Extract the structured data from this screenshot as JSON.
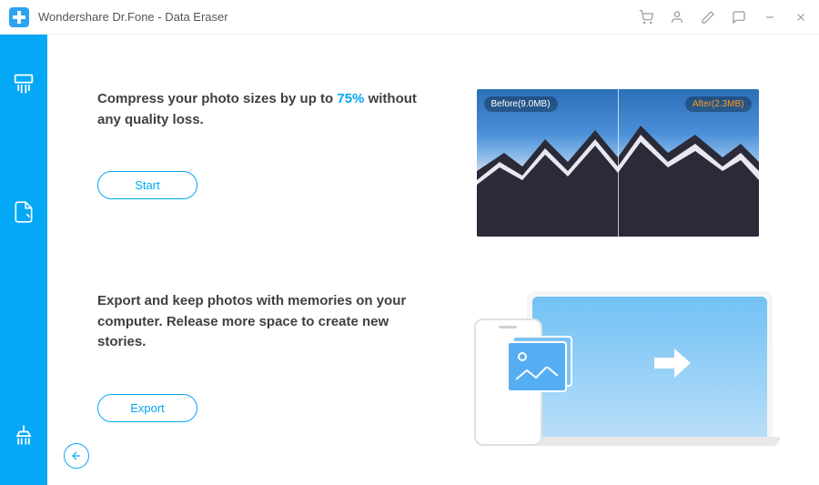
{
  "app": {
    "title": "Wondershare Dr.Fone - Data Eraser"
  },
  "sidebar": {
    "items": [
      {
        "name": "shredder"
      },
      {
        "name": "private-data"
      },
      {
        "name": "cleaner"
      }
    ]
  },
  "sections": {
    "compress": {
      "heading_before": "Compress your photo sizes by up to ",
      "heading_accent": "75%",
      "heading_after": " without any quality loss.",
      "button": "Start",
      "before_label": "Before(9.0MB)",
      "after_label": "After(2.3MB)"
    },
    "export": {
      "heading": "Export and keep photos with memories on your computer. Release more space to create new stories.",
      "button": "Export"
    }
  },
  "back_button": "←"
}
